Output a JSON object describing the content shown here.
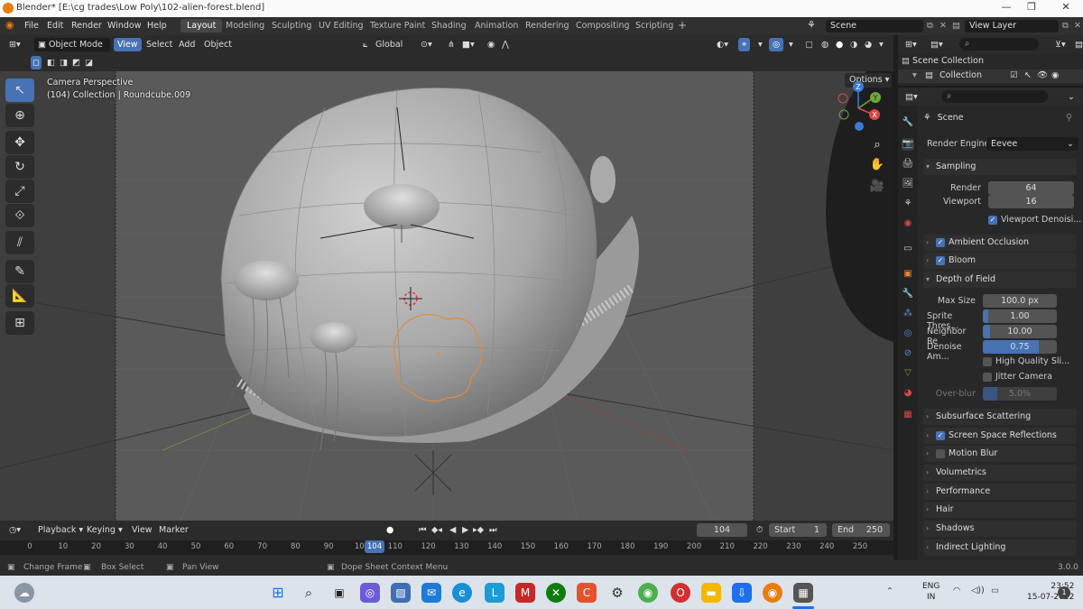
{
  "window": {
    "title": "Blender* [E:\\cg trades\\Low Poly\\102-alien-forest.blend]",
    "minimize": "—",
    "maximize": "❐",
    "close": "✕"
  },
  "menubar": {
    "menus": [
      "File",
      "Edit",
      "Render",
      "Window",
      "Help"
    ],
    "workspaces": [
      "Layout",
      "Modeling",
      "Sculpting",
      "UV Editing",
      "Texture Paint",
      "Shading",
      "Animation",
      "Rendering",
      "Compositing",
      "Scripting"
    ],
    "add_workspace": "+",
    "scene_label": "Scene",
    "view_layer_label": "View Layer"
  },
  "viewport_header": {
    "mode": "Object Mode",
    "menus": [
      "View",
      "Select",
      "Add",
      "Object"
    ],
    "transform_orientation": "Global",
    "options": "Options"
  },
  "viewport": {
    "camera_label": "Camera Perspective",
    "collection_info": "(104) Collection | Roundcube.009",
    "axes": {
      "x": "X",
      "y": "Y",
      "z": "Z"
    }
  },
  "timeline": {
    "menus": [
      "Playback",
      "Keying",
      "View",
      "Marker"
    ],
    "current_frame": "104",
    "start_label": "Start",
    "start_value": "1",
    "end_label": "End",
    "end_value": "250",
    "ruler": [
      "0",
      "10",
      "20",
      "30",
      "40",
      "50",
      "60",
      "70",
      "80",
      "90",
      "100",
      "110",
      "120",
      "130",
      "140",
      "150",
      "160",
      "170",
      "180",
      "190",
      "200",
      "210",
      "220",
      "230",
      "240",
      "250"
    ]
  },
  "statusbar": {
    "change_frame": "Change Frame",
    "box_select": "Box Select",
    "pan_view": "Pan View",
    "context_menu": "Dope Sheet Context Menu",
    "version": "3.0.0"
  },
  "outliner": {
    "items": [
      "Scene Collection",
      "Collection"
    ]
  },
  "properties": {
    "context": "Scene",
    "render_engine_label": "Render Engine",
    "render_engine": "Eevee",
    "sampling": {
      "title": "Sampling",
      "render_label": "Render",
      "render_value": "64",
      "viewport_label": "Viewport",
      "viewport_value": "16",
      "denoise_label": "Viewport Denoisi..."
    },
    "panels_top": [
      {
        "label": "Ambient Occlusion",
        "checked": true
      },
      {
        "label": "Bloom",
        "checked": true
      }
    ],
    "dof": {
      "title": "Depth of Field",
      "max_size_label": "Max Size",
      "max_size_value": "100.0 px",
      "sprite_label": "Sprite Thres...",
      "sprite_value": "1.00",
      "neighbor_label": "Neighbor Re",
      "neighbor_value": "10.00",
      "denoise_label": "Denoise Am...",
      "denoise_value": "0.75",
      "high_quality_label": "High Quality Sli...",
      "jitter_label": "Jitter Camera",
      "overblur_label": "Over-blur",
      "overblur_value": "5.0%"
    },
    "panels_bottom": [
      {
        "label": "Subsurface Scattering",
        "checkbox": null
      },
      {
        "label": "Screen Space Reflections",
        "checkbox": true
      },
      {
        "label": "Motion Blur",
        "checkbox": false
      },
      {
        "label": "Volumetrics",
        "checkbox": null
      },
      {
        "label": "Performance",
        "checkbox": null
      },
      {
        "label": "Hair",
        "checkbox": null
      },
      {
        "label": "Shadows",
        "checkbox": null
      },
      {
        "label": "Indirect Lighting",
        "checkbox": null
      }
    ]
  },
  "taskbar": {
    "lang_top": "ENG",
    "lang_bottom": "IN",
    "time": "23:52",
    "date": "15-07-2022",
    "notifications": "1"
  }
}
